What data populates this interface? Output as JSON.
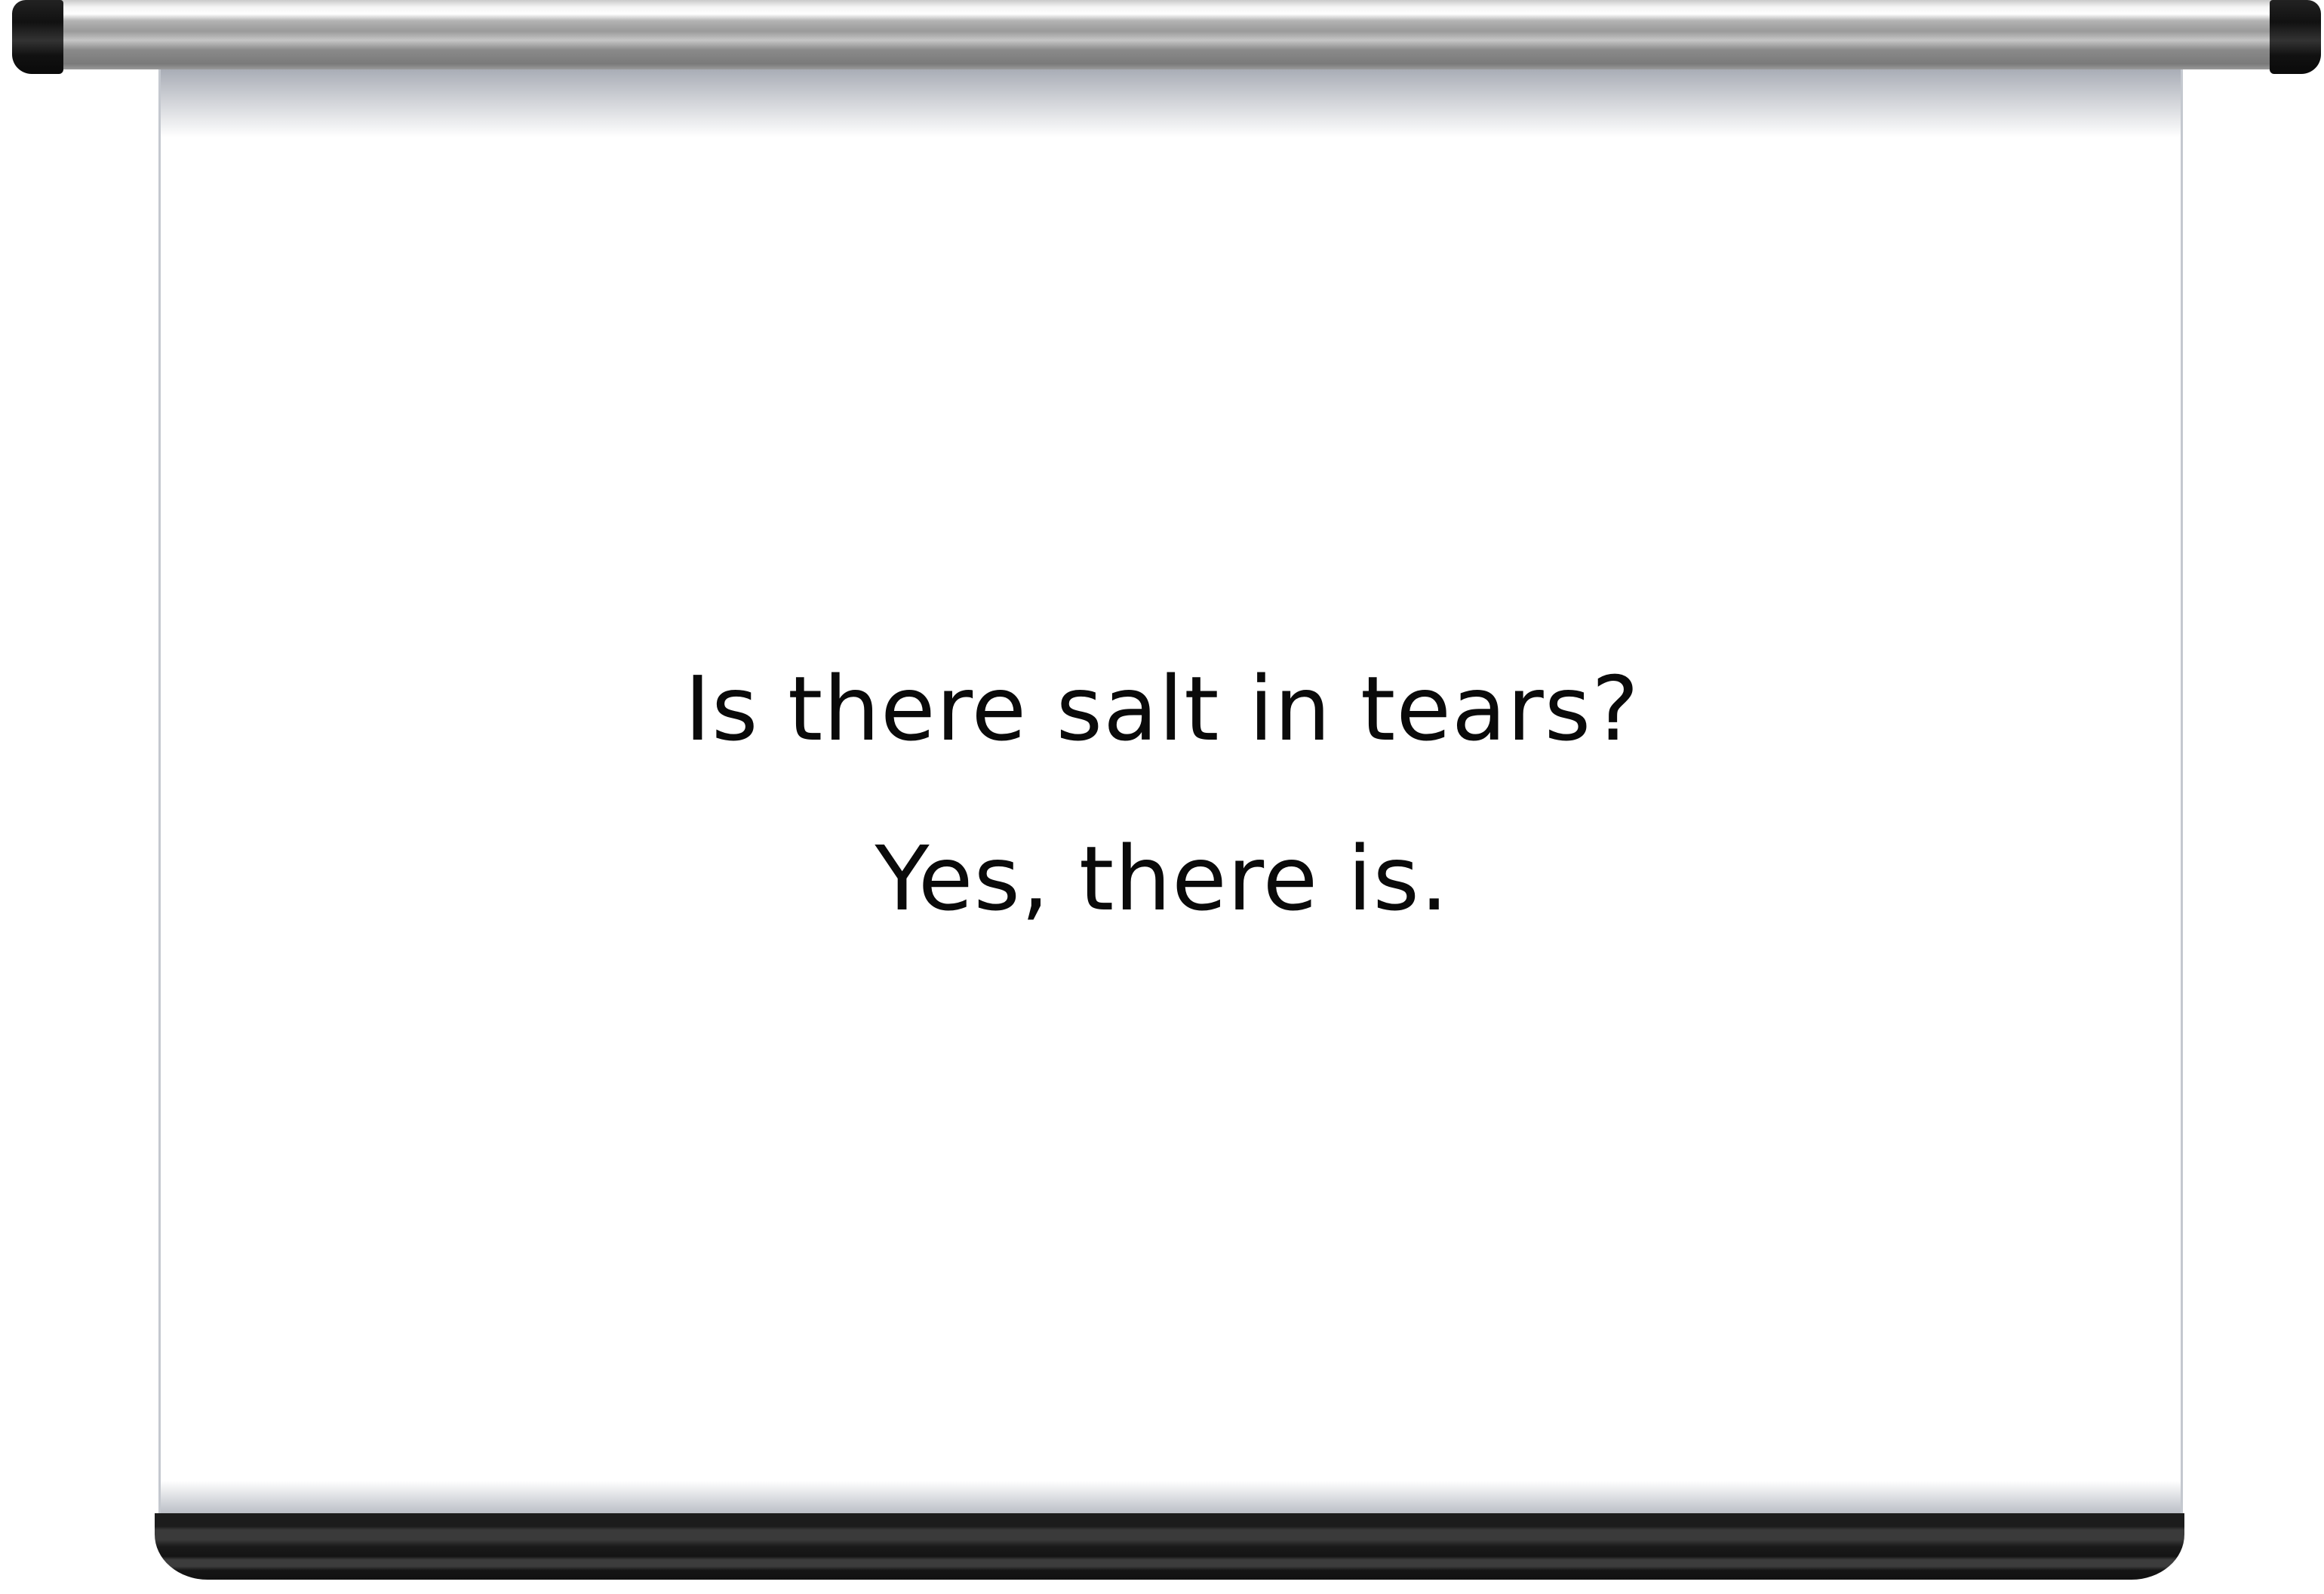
{
  "slide": {
    "line1": "Is there salt in tears?",
    "line2": "Yes, there is."
  }
}
